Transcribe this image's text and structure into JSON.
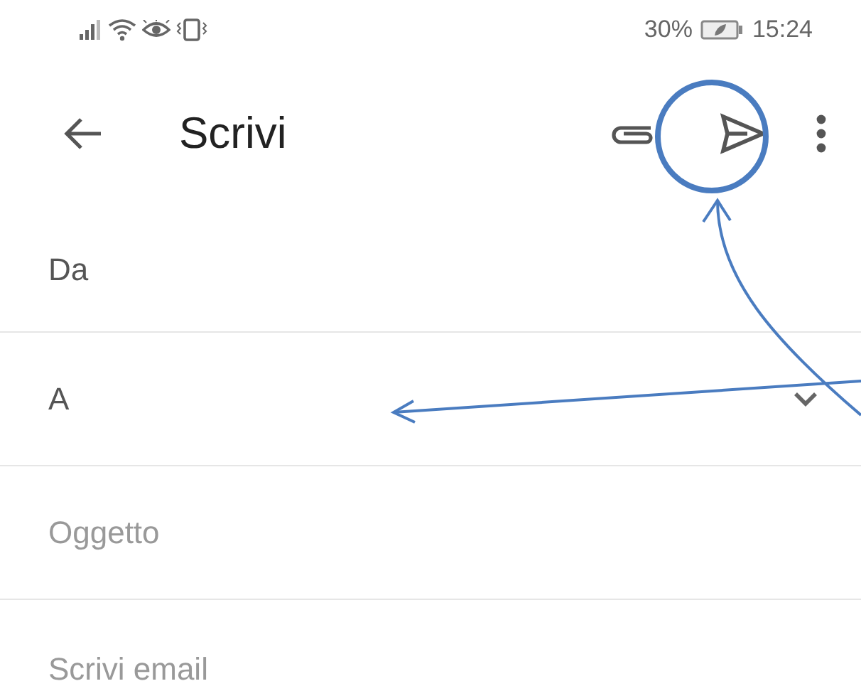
{
  "status_bar": {
    "battery": "30%",
    "time": "15:24"
  },
  "toolbar": {
    "title": "Scrivi"
  },
  "fields": [
    {
      "kind": "label",
      "label": "Da",
      "expandable": false
    },
    {
      "kind": "label",
      "label": "A",
      "expandable": true
    },
    {
      "kind": "input",
      "placeholder": "Oggetto",
      "expandable": false
    },
    {
      "kind": "input",
      "placeholder": "Scrivi email",
      "expandable": false
    }
  ]
}
